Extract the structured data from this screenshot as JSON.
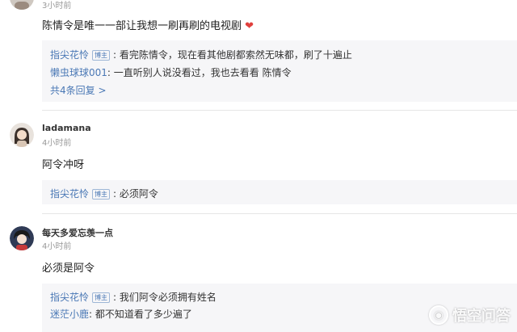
{
  "comment1": {
    "time": "3小时前",
    "content": "陈情令是唯一一部让我想一刷再刷的电视剧",
    "heart": "❤",
    "replies": [
      {
        "name": "指尖花怜",
        "badge": "博主",
        "text": ": 看完陈情令，现在看其他剧都索然无味都，刷了十遍止"
      },
      {
        "name": "懒虫球球001",
        "text": ": 一直听别人说没看过，我也去看看 陈情令"
      }
    ],
    "more": "共4条回复 >"
  },
  "comment2": {
    "username": "ladamana",
    "time": "4小时前",
    "content": "阿令冲呀",
    "replies": [
      {
        "name": "指尖花怜",
        "badge": "博主",
        "text": ": 必须阿令"
      }
    ]
  },
  "comment3": {
    "username": "每天多爱忘羡一点",
    "time": "4小时前",
    "content": "必须是阿令",
    "replies": [
      {
        "name": "指尖花怜",
        "badge": "博主",
        "text": ": 我们阿令必须拥有姓名"
      },
      {
        "name": "迷茫小鹿",
        "text": ": 都不知道看了多少遍了"
      }
    ]
  },
  "watermark": {
    "text": "悟空问答",
    "icon": "wukong-logo"
  },
  "colors": {
    "link": "#4a78b5",
    "reply_bg": "#f6f6f8",
    "heart": "#e0403d"
  }
}
